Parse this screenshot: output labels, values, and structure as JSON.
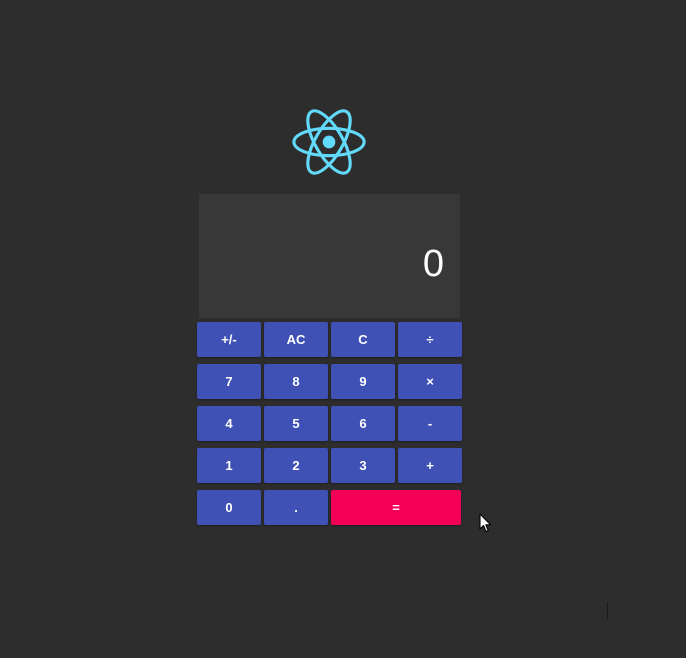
{
  "theme": {
    "background": "#2e2d2d",
    "display_background": "#383838",
    "key_color": "#3f51b5",
    "equals_color": "#f50057",
    "logo_color": "#61dafb"
  },
  "logo": {
    "icon": "react-atom-icon"
  },
  "display": {
    "value": "0"
  },
  "keys": {
    "plus_minus": "+/-",
    "all_clear": "AC",
    "clear": "C",
    "divide": "÷",
    "seven": "7",
    "eight": "8",
    "nine": "9",
    "multiply": "×",
    "four": "4",
    "five": "5",
    "six": "6",
    "subtract": "-",
    "one": "1",
    "two": "2",
    "three": "3",
    "add": "+",
    "zero": "0",
    "decimal": ".",
    "equals": "="
  }
}
